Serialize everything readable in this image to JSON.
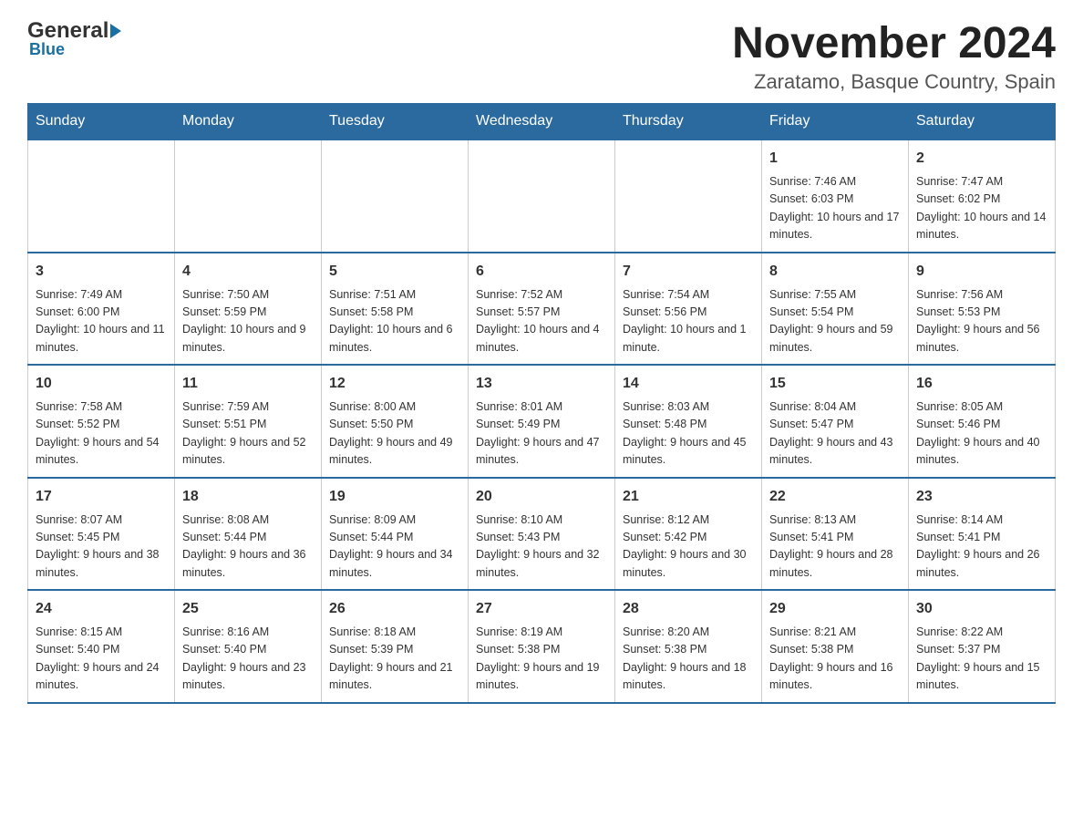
{
  "header": {
    "logo": {
      "general": "General",
      "blue": "Blue"
    },
    "title": "November 2024",
    "subtitle": "Zaratamo, Basque Country, Spain"
  },
  "weekdays": [
    "Sunday",
    "Monday",
    "Tuesday",
    "Wednesday",
    "Thursday",
    "Friday",
    "Saturday"
  ],
  "weeks": [
    [
      {
        "day": "",
        "info": ""
      },
      {
        "day": "",
        "info": ""
      },
      {
        "day": "",
        "info": ""
      },
      {
        "day": "",
        "info": ""
      },
      {
        "day": "",
        "info": ""
      },
      {
        "day": "1",
        "info": "Sunrise: 7:46 AM\nSunset: 6:03 PM\nDaylight: 10 hours and 17 minutes."
      },
      {
        "day": "2",
        "info": "Sunrise: 7:47 AM\nSunset: 6:02 PM\nDaylight: 10 hours and 14 minutes."
      }
    ],
    [
      {
        "day": "3",
        "info": "Sunrise: 7:49 AM\nSunset: 6:00 PM\nDaylight: 10 hours and 11 minutes."
      },
      {
        "day": "4",
        "info": "Sunrise: 7:50 AM\nSunset: 5:59 PM\nDaylight: 10 hours and 9 minutes."
      },
      {
        "day": "5",
        "info": "Sunrise: 7:51 AM\nSunset: 5:58 PM\nDaylight: 10 hours and 6 minutes."
      },
      {
        "day": "6",
        "info": "Sunrise: 7:52 AM\nSunset: 5:57 PM\nDaylight: 10 hours and 4 minutes."
      },
      {
        "day": "7",
        "info": "Sunrise: 7:54 AM\nSunset: 5:56 PM\nDaylight: 10 hours and 1 minute."
      },
      {
        "day": "8",
        "info": "Sunrise: 7:55 AM\nSunset: 5:54 PM\nDaylight: 9 hours and 59 minutes."
      },
      {
        "day": "9",
        "info": "Sunrise: 7:56 AM\nSunset: 5:53 PM\nDaylight: 9 hours and 56 minutes."
      }
    ],
    [
      {
        "day": "10",
        "info": "Sunrise: 7:58 AM\nSunset: 5:52 PM\nDaylight: 9 hours and 54 minutes."
      },
      {
        "day": "11",
        "info": "Sunrise: 7:59 AM\nSunset: 5:51 PM\nDaylight: 9 hours and 52 minutes."
      },
      {
        "day": "12",
        "info": "Sunrise: 8:00 AM\nSunset: 5:50 PM\nDaylight: 9 hours and 49 minutes."
      },
      {
        "day": "13",
        "info": "Sunrise: 8:01 AM\nSunset: 5:49 PM\nDaylight: 9 hours and 47 minutes."
      },
      {
        "day": "14",
        "info": "Sunrise: 8:03 AM\nSunset: 5:48 PM\nDaylight: 9 hours and 45 minutes."
      },
      {
        "day": "15",
        "info": "Sunrise: 8:04 AM\nSunset: 5:47 PM\nDaylight: 9 hours and 43 minutes."
      },
      {
        "day": "16",
        "info": "Sunrise: 8:05 AM\nSunset: 5:46 PM\nDaylight: 9 hours and 40 minutes."
      }
    ],
    [
      {
        "day": "17",
        "info": "Sunrise: 8:07 AM\nSunset: 5:45 PM\nDaylight: 9 hours and 38 minutes."
      },
      {
        "day": "18",
        "info": "Sunrise: 8:08 AM\nSunset: 5:44 PM\nDaylight: 9 hours and 36 minutes."
      },
      {
        "day": "19",
        "info": "Sunrise: 8:09 AM\nSunset: 5:44 PM\nDaylight: 9 hours and 34 minutes."
      },
      {
        "day": "20",
        "info": "Sunrise: 8:10 AM\nSunset: 5:43 PM\nDaylight: 9 hours and 32 minutes."
      },
      {
        "day": "21",
        "info": "Sunrise: 8:12 AM\nSunset: 5:42 PM\nDaylight: 9 hours and 30 minutes."
      },
      {
        "day": "22",
        "info": "Sunrise: 8:13 AM\nSunset: 5:41 PM\nDaylight: 9 hours and 28 minutes."
      },
      {
        "day": "23",
        "info": "Sunrise: 8:14 AM\nSunset: 5:41 PM\nDaylight: 9 hours and 26 minutes."
      }
    ],
    [
      {
        "day": "24",
        "info": "Sunrise: 8:15 AM\nSunset: 5:40 PM\nDaylight: 9 hours and 24 minutes."
      },
      {
        "day": "25",
        "info": "Sunrise: 8:16 AM\nSunset: 5:40 PM\nDaylight: 9 hours and 23 minutes."
      },
      {
        "day": "26",
        "info": "Sunrise: 8:18 AM\nSunset: 5:39 PM\nDaylight: 9 hours and 21 minutes."
      },
      {
        "day": "27",
        "info": "Sunrise: 8:19 AM\nSunset: 5:38 PM\nDaylight: 9 hours and 19 minutes."
      },
      {
        "day": "28",
        "info": "Sunrise: 8:20 AM\nSunset: 5:38 PM\nDaylight: 9 hours and 18 minutes."
      },
      {
        "day": "29",
        "info": "Sunrise: 8:21 AM\nSunset: 5:38 PM\nDaylight: 9 hours and 16 minutes."
      },
      {
        "day": "30",
        "info": "Sunrise: 8:22 AM\nSunset: 5:37 PM\nDaylight: 9 hours and 15 minutes."
      }
    ]
  ]
}
